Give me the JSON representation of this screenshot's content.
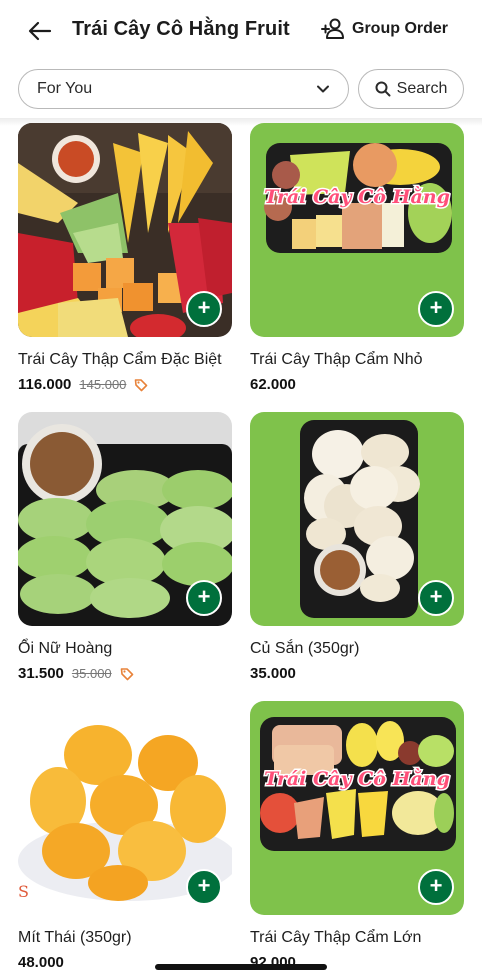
{
  "header": {
    "title": "Trái Cây Cô Hằng Fruit",
    "group_order_label": "Group Order",
    "back_icon": "arrow-left-icon",
    "group_icon": "add-group-icon"
  },
  "filters": {
    "category_value": "For You",
    "search_label": "Search"
  },
  "colors": {
    "accent": "#00703c",
    "card_green": "#7fc24b",
    "discount_tag": "#e8833a"
  },
  "products": [
    {
      "name": "Trái Cây Thập Cẩm Đặc Biệt",
      "price": "116.000",
      "old_price": "145.000",
      "has_discount": true
    },
    {
      "name": "Trái Cây Thập Cẩm Nhỏ",
      "price": "62.000",
      "old_price": "",
      "has_discount": false,
      "label_overlay": "Trái Cây Cô Hằng"
    },
    {
      "name": "Ổi Nữ Hoàng",
      "price": "31.500",
      "old_price": "35.000",
      "has_discount": true
    },
    {
      "name": "Củ Sắn (350gr)",
      "price": "35.000",
      "old_price": "",
      "has_discount": false
    },
    {
      "name": "Mít Thái (350gr)",
      "price": "48.000",
      "old_price": "",
      "has_discount": false
    },
    {
      "name": "Trái Cây Thập Cẩm Lớn",
      "price": "92.000",
      "old_price": "",
      "has_discount": false,
      "label_overlay": "Trái Cây Cô Hằng"
    }
  ]
}
